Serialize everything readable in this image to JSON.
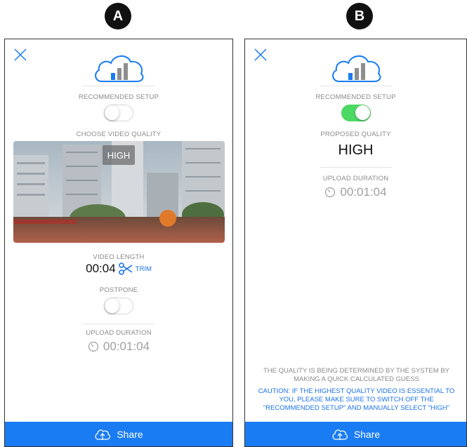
{
  "badges": {
    "a": "A",
    "b": "B"
  },
  "panel_a": {
    "recommended_setup_label": "RECOMMENDED SETUP",
    "recommended_setup_on": false,
    "choose_quality_label": "CHOOSE VIDEO QUALITY",
    "quality_badge": "HIGH",
    "video_length_label": "VIDEO LENGTH",
    "video_length_value": "00:04",
    "trim_label": "TRIM",
    "postpone_label": "POSTPONE",
    "postpone_on": false,
    "upload_duration_label": "UPLOAD DURATION",
    "upload_duration_value": "00:01:04",
    "share_label": "Share"
  },
  "panel_b": {
    "recommended_setup_label": "RECOMMENDED SETUP",
    "recommended_setup_on": true,
    "proposed_quality_label": "PROPOSED QUALITY",
    "proposed_quality_value": "HIGH",
    "upload_duration_label": "UPLOAD DURATION",
    "upload_duration_value": "00:01:04",
    "info_note": "THE QUALITY IS BEING DETERMINED BY THE SYSTEM BY MAKING A QUICK CALCULATED GUESS",
    "caution_note": "CAUTION: IF THE HIGHEST QUALITY VIDEO IS ESSENTIAL TO YOU, PLEASE MAKE SURE TO SWITCH OFF THE \"RECOMMENDED SETUP\" AND MANUALLY SELECT \"HIGH\"",
    "share_label": "Share"
  },
  "icons": {
    "close": "close-icon",
    "cloud": "cloud-signal-icon",
    "trim": "scissors-icon",
    "timer": "timer-icon",
    "share": "cloud-upload-icon"
  },
  "colors": {
    "accent": "#1a7cf2",
    "toggle_on": "#4cd964",
    "muted_text": "#8a8a8a"
  }
}
